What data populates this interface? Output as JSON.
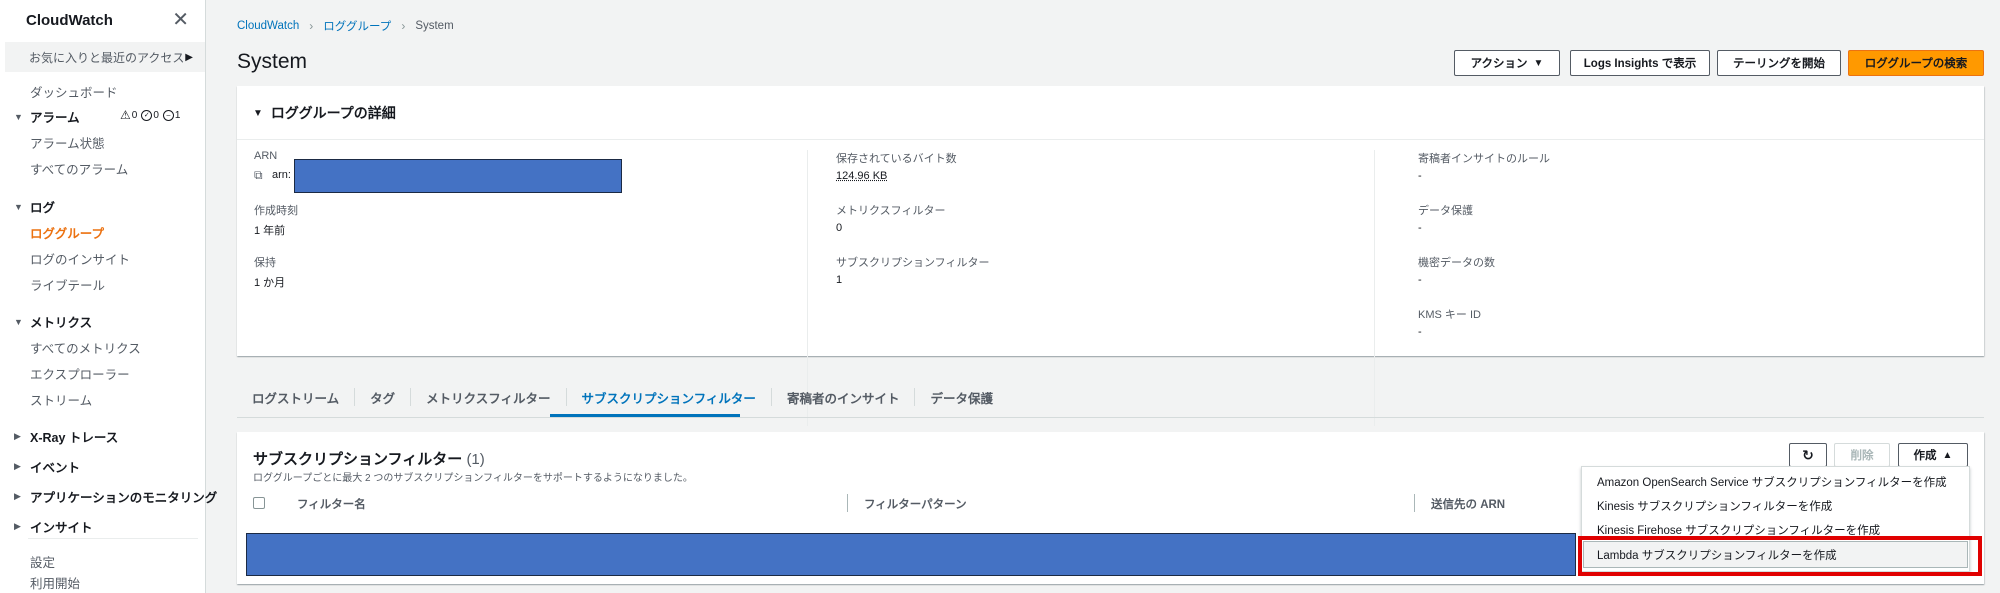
{
  "sidebar": {
    "title": "CloudWatch",
    "close_icon": "close-icon",
    "favorites_label": "お気に入りと最近のアクセス",
    "dashboard": "ダッシュボード",
    "alarms": {
      "label": "アラーム",
      "warn_count": "0",
      "ok_count": "0",
      "insufficient_count": "1",
      "items": [
        "アラーム状態",
        "すべてのアラーム"
      ]
    },
    "logs": {
      "label": "ログ",
      "items": [
        "ロググループ",
        "ログのインサイト",
        "ライブテール"
      ]
    },
    "metrics": {
      "label": "メトリクス",
      "items": [
        "すべてのメトリクス",
        "エクスプローラー",
        "ストリーム"
      ]
    },
    "xray": "X-Ray トレース",
    "events": "イベント",
    "app_monitoring": "アプリケーションのモニタリング",
    "insights": "インサイト",
    "settings": "設定",
    "getting_started": "利用開始"
  },
  "breadcrumb": {
    "items": [
      "CloudWatch",
      "ロググループ",
      "System"
    ]
  },
  "page": {
    "title": "System"
  },
  "header_buttons": {
    "actions": "アクション",
    "logs_insights": "Logs Insights で表示",
    "tailing": "テーリングを開始",
    "search": "ロググループの検索"
  },
  "details": {
    "title": "ロググループの詳細",
    "arn_label": "ARN",
    "arn_prefix": "arn:",
    "created_label": "作成時刻",
    "created_value": "1 年前",
    "retention_label": "保持",
    "retention_value": "1 か月",
    "stored_bytes_label": "保存されているバイト数",
    "stored_bytes_value": "124.96 KB",
    "metric_filters_label": "メトリクスフィルター",
    "metric_filters_value": "0",
    "subscription_filters_label": "サブスクリプションフィルター",
    "subscription_filters_value": "1",
    "contributor_rules_label": "寄稿者インサイトのルール",
    "contributor_rules_value": "-",
    "data_protection_label": "データ保護",
    "data_protection_value": "-",
    "sensitive_data_label": "機密データの数",
    "sensitive_data_value": "-",
    "kms_label": "KMS キー ID",
    "kms_value": "-"
  },
  "tabs": [
    "ログストリーム",
    "タグ",
    "メトリクスフィルター",
    "サブスクリプションフィルター",
    "寄稿者のインサイト",
    "データ保護"
  ],
  "active_tab": "サブスクリプションフィルター",
  "subscription_panel": {
    "title": "サブスクリプションフィルター",
    "count": "(1)",
    "description": "ロググループごとに最大 2 つのサブスクリプションフィルターをサポートするようになりました。",
    "refresh_icon": "refresh-icon",
    "delete_label": "削除",
    "create_label": "作成",
    "columns": [
      "フィルター名",
      "フィルターパターン",
      "送信先の ARN"
    ]
  },
  "create_menu": {
    "items": [
      "Amazon OpenSearch Service サブスクリプションフィルターを作成",
      "Kinesis サブスクリプションフィルターを作成",
      "Kinesis Firehose サブスクリプションフィルターを作成",
      "Lambda サブスクリプションフィルターを作成"
    ],
    "highlighted_index": 3
  },
  "colors": {
    "accent_orange": "#ff9900",
    "link_blue": "#0073bb",
    "redaction": "#4472c4",
    "highlight_red": "#e00000"
  }
}
